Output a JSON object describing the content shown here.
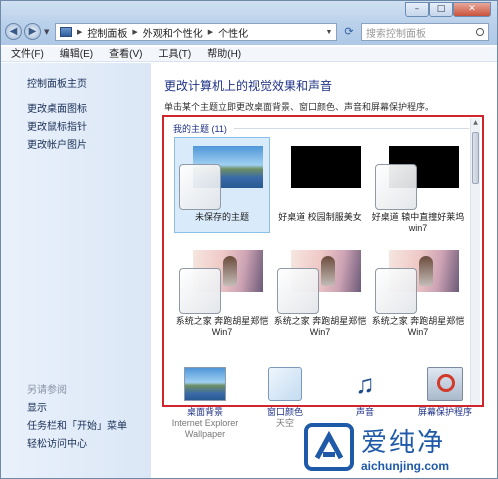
{
  "address": {
    "crumbs": [
      "控制面板",
      "外观和个性化",
      "个性化"
    ],
    "search_placeholder": "搜索控制面板"
  },
  "menu": [
    "文件(F)",
    "编辑(E)",
    "查看(V)",
    "工具(T)",
    "帮助(H)"
  ],
  "sidebar": {
    "links": [
      "控制面板主页",
      "更改桌面图标",
      "更改鼠标指针",
      "更改帐户图片"
    ],
    "see_also_heading": "另请参阅",
    "see_also": [
      "显示",
      "任务栏和「开始」菜单",
      "轻松访问中心"
    ]
  },
  "main": {
    "title": "更改计算机上的视觉效果和声音",
    "subtitle": "单击某个主题立即更改桌面背景、窗口颜色、声音和屏幕保护程序。",
    "group_label": "我的主题 (11)",
    "themes": [
      {
        "label": "未保存的主题",
        "thumb": "lake",
        "selected": true
      },
      {
        "label": "好桌道 校园制服美女",
        "thumb": "black",
        "selected": false
      },
      {
        "label": "好桌道 辕中直撞好莱坞win7",
        "thumb": "black",
        "selected": false
      },
      {
        "label": "系统之家 奔跑胡星郑恺Win7",
        "thumb": "person",
        "selected": false
      },
      {
        "label": "系统之家 奔跑胡星郑恺Win7",
        "thumb": "person",
        "selected": false
      },
      {
        "label": "系统之家 奔跑胡星郑恺Win7",
        "thumb": "person",
        "selected": false
      }
    ]
  },
  "bottom": {
    "desktop_bg": {
      "label": "桌面背景",
      "sub": "Internet Explorer Wallpaper"
    },
    "window_color": {
      "label": "窗口颜色",
      "sub": "天空"
    },
    "sound": {
      "label": "声音"
    },
    "screensaver": {
      "label": "屏幕保护程序"
    }
  },
  "watermark": {
    "cn": "爱纯净",
    "url": "aichunjing.com"
  },
  "colors": {
    "accent": "#1e3287",
    "highlight_border": "#d0252c",
    "selected_tile": "#d9ebfb"
  }
}
